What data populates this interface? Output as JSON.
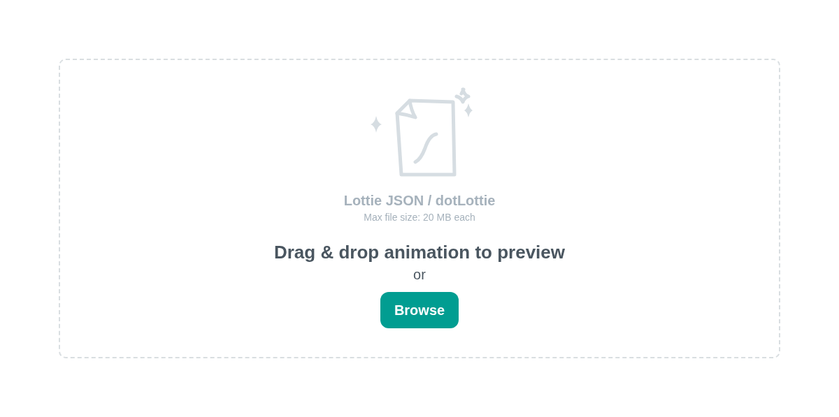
{
  "dropzone": {
    "format_title": "Lottie JSON / dotLottie",
    "size_hint": "Max file size: 20 MB each",
    "heading": "Drag & drop animation to preview",
    "separator": "or",
    "button": "Browse"
  }
}
